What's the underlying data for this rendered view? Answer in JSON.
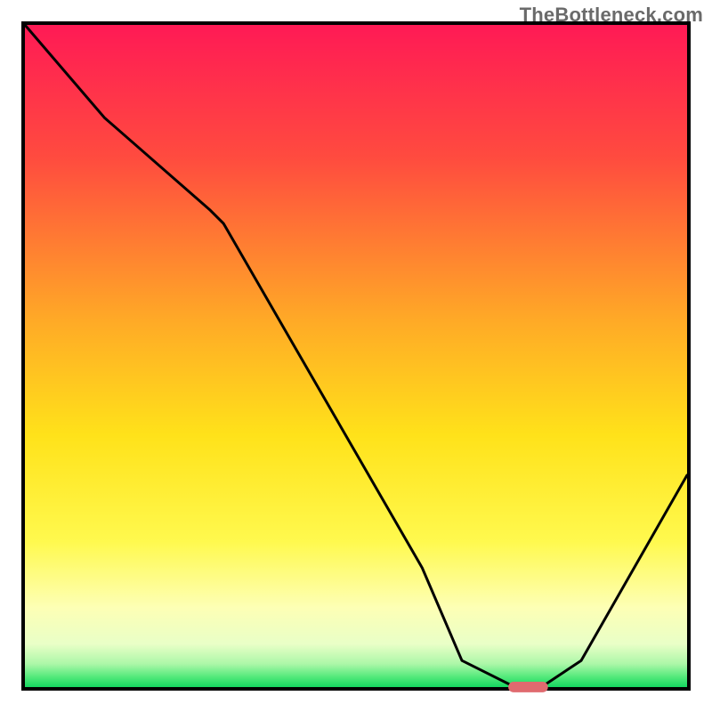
{
  "watermark": "TheBottleneck.com",
  "chart_data": {
    "type": "line",
    "title": "",
    "xlabel": "",
    "ylabel": "",
    "xlim": [
      0,
      100
    ],
    "ylim": [
      0,
      100
    ],
    "legend": false,
    "grid": false,
    "background_gradient": {
      "stops": [
        {
          "offset": 0.0,
          "color": "#ff1a55"
        },
        {
          "offset": 0.2,
          "color": "#ff4b3f"
        },
        {
          "offset": 0.45,
          "color": "#ffab26"
        },
        {
          "offset": 0.62,
          "color": "#ffe21a"
        },
        {
          "offset": 0.78,
          "color": "#fff94e"
        },
        {
          "offset": 0.88,
          "color": "#fdffb5"
        },
        {
          "offset": 0.935,
          "color": "#e9ffc7"
        },
        {
          "offset": 0.965,
          "color": "#acf7a8"
        },
        {
          "offset": 0.985,
          "color": "#52e97a"
        },
        {
          "offset": 1.0,
          "color": "#14d760"
        }
      ]
    },
    "series": [
      {
        "name": "bottleneck-curve",
        "color": "#000000",
        "x": [
          0,
          12,
          28,
          30,
          60,
          66,
          74,
          78,
          84,
          100
        ],
        "y": [
          100,
          86,
          72,
          70,
          18,
          4,
          0,
          0,
          4,
          32
        ]
      }
    ],
    "marker": {
      "name": "optimal-point",
      "x": 76,
      "y": 0,
      "width": 6,
      "height": 1.6,
      "color": "#e06a6f"
    }
  }
}
